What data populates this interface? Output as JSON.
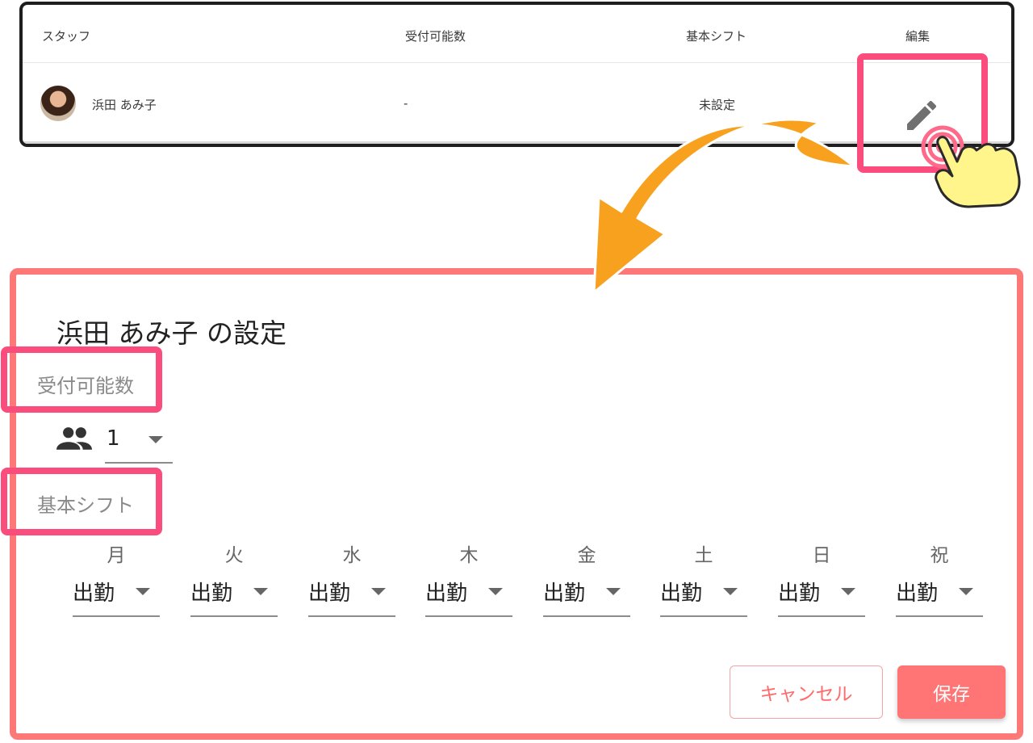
{
  "colors": {
    "highlight": "#fb4d7d",
    "dialog_border": "#ff7878",
    "primary": "#ff7575",
    "arrow": "#f7a11f",
    "hand": "#fff58a"
  },
  "staff_table": {
    "headers": {
      "staff": "スタッフ",
      "capacity": "受付可能数",
      "base_shift": "基本シフト",
      "edit": "編集"
    },
    "rows": [
      {
        "name": "浜田 あみ子",
        "capacity": "-",
        "base_shift": "未設定",
        "edit_icon": "pencil-icon"
      }
    ]
  },
  "annotation": {
    "arrow_icon": "curved-arrow",
    "hand_icon": "pointing-hand-tap-icon"
  },
  "dialog": {
    "title": "浜田 あみ子 の設定",
    "capacity": {
      "label": "受付可能数",
      "icon": "people-icon",
      "value": "1"
    },
    "shift": {
      "label": "基本シフト",
      "days": [
        {
          "label": "月",
          "value": "出勤"
        },
        {
          "label": "火",
          "value": "出勤"
        },
        {
          "label": "水",
          "value": "出勤"
        },
        {
          "label": "木",
          "value": "出勤"
        },
        {
          "label": "金",
          "value": "出勤"
        },
        {
          "label": "土",
          "value": "出勤"
        },
        {
          "label": "日",
          "value": "出勤"
        },
        {
          "label": "祝",
          "value": "出勤"
        }
      ]
    },
    "buttons": {
      "cancel": "キャンセル",
      "save": "保存"
    }
  }
}
